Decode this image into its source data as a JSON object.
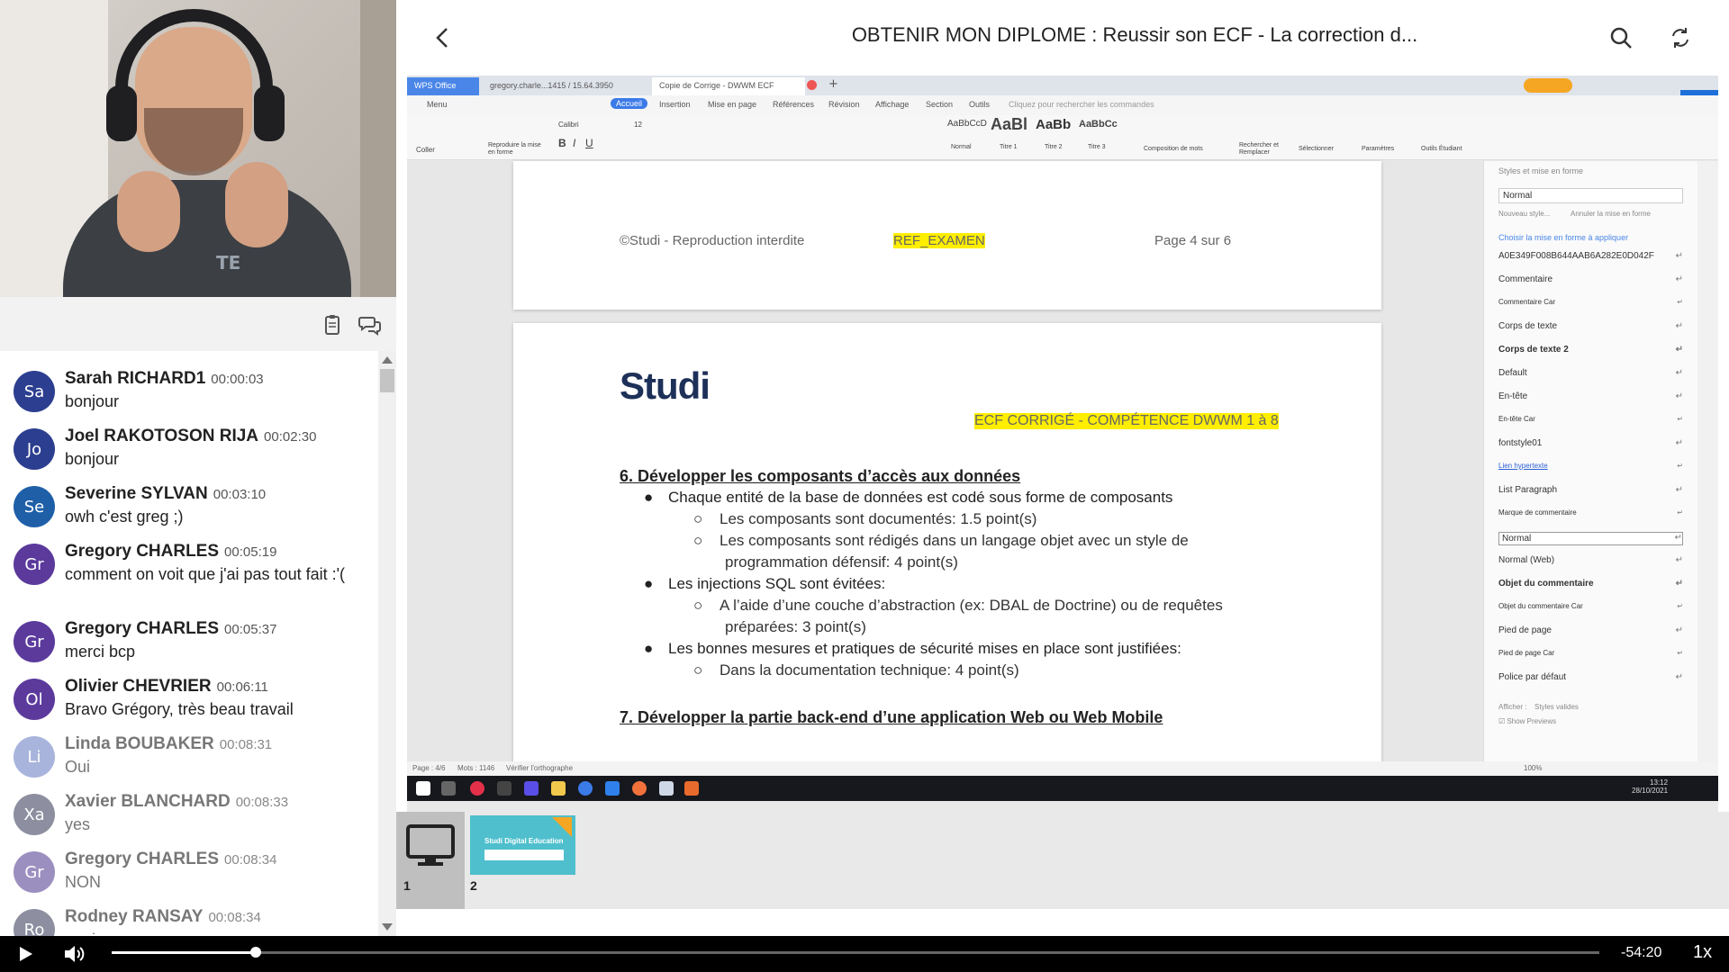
{
  "header": {
    "title": "OBTENIR MON DIPLOME : Reussir son ECF - La correction d..."
  },
  "chat": {
    "messages": [
      {
        "initials": "Sa",
        "author": "Sarah RICHARD1",
        "time": "00:00:03",
        "text": "bonjour",
        "color": "#2c3e8f",
        "faded": false
      },
      {
        "initials": "Jo",
        "author": "Joel RAKOTOSON RIJA",
        "time": "00:02:30",
        "text": "bonjour",
        "color": "#2c3e8f",
        "faded": false
      },
      {
        "initials": "Se",
        "author": "Severine SYLVAN",
        "time": "00:03:10",
        "text": "owh c'est greg ;)",
        "color": "#1f5fa8",
        "faded": false
      },
      {
        "initials": "Gr",
        "author": "Gregory CHARLES",
        "time": "00:05:19",
        "text": "comment on voit que j'ai pas tout fait :'(",
        "color": "#5b3a9c",
        "faded": false
      },
      {
        "initials": "Gr",
        "author": "Gregory CHARLES",
        "time": "00:05:37",
        "text": "merci bcp",
        "color": "#5b3a9c",
        "faded": false
      },
      {
        "initials": "Ol",
        "author": "Olivier CHEVRIER",
        "time": "00:06:11",
        "text": "Bravo Grégory, très beau travail",
        "color": "#5b3a9c",
        "faded": false
      },
      {
        "initials": "Li",
        "author": "Linda BOUBAKER",
        "time": "00:08:31",
        "text": "Oui",
        "color": "#a8b4dc",
        "faded": true
      },
      {
        "initials": "Xa",
        "author": "Xavier BLANCHARD",
        "time": "00:08:33",
        "text": "yes",
        "color": "#8d8fa0",
        "faded": true
      },
      {
        "initials": "Gr",
        "author": "Gregory CHARLES",
        "time": "00:08:34",
        "text": "NON",
        "color": "#9b8fc0",
        "faded": true
      },
      {
        "initials": "Ro",
        "author": "Rodney RANSAY",
        "time": "00:08:34",
        "text": "ouais",
        "color": "#8d8fa0",
        "faded": true
      }
    ]
  },
  "wps": {
    "tabs": [
      "WPS Office",
      "gregory.charle...1415 / 15.64.3950",
      "Copie de Corrige - DWWM ECF"
    ],
    "menu": [
      "Menu",
      "Accueil",
      "Insertion",
      "Mise en page",
      "Références",
      "Révision",
      "Affichage",
      "Section",
      "Outils",
      "Cliquez pour rechercher les commandes"
    ],
    "ribbon": {
      "font_name": "Calibri",
      "font_size": "12",
      "styles": [
        "AaBbCcD",
        "AaBl",
        "AaBb",
        "AaBbCc"
      ],
      "style_names": [
        "Normal",
        "Titre 1",
        "Titre 2",
        "Titre 3"
      ],
      "labels": [
        "Coller",
        "Reproduire la mise en forme",
        "Composition de mots",
        "Rechercher et Remplacer",
        "Sélectionner",
        "Paramètres",
        "Outils Étudiant"
      ]
    }
  },
  "document": {
    "footer_left": "©Studi - Reproduction interdite",
    "footer_mid": "REF_EXAMEN",
    "footer_right": "Page 4 sur 6",
    "logo": "Studi",
    "badge": "ECF CORRIGÉ - COMPÉTENCE DWWM 1 à 8",
    "section6": "6. Développer les composants d’accès aux données",
    "b1": "Chaque entité de la base de données est codé sous forme de composants",
    "b1_1": "Les composants sont documentés:  1.5 point(s)",
    "b1_2a": "Les composants sont rédigés dans un langage objet avec un style de",
    "b1_2b": "programmation défensif: 4 point(s)",
    "b2": "Les injections SQL sont évitées:",
    "b2_1a": "A l’aide d’une couche d’abstraction (ex: DBAL de Doctrine) ou de requêtes",
    "b2_1b": "préparées: 3 point(s)",
    "b3": "Les bonnes mesures et pratiques de sécurité mises en place sont justifiées:",
    "b3_1": "Dans la documentation technique:  4 point(s)",
    "section7": "7. Développer la partie back-end d’une application Web ou Web Mobile"
  },
  "styles_panel": {
    "title": "Styles et mise en forme",
    "current": "Normal",
    "new_style": "Nouveau style...",
    "clear": "Annuler la mise en forme",
    "choose": "Choisir la mise en forme à appliquer",
    "items": [
      "A0E349F008B644AAB6A282E0D042F",
      "Commentaire",
      "Commentaire Car",
      "Corps de texte",
      "Corps de texte 2",
      "Default",
      "En-tête",
      "En-tête Car",
      "fontstyle01",
      "Lien hypertexte",
      "List Paragraph",
      "Marque de commentaire",
      "Normal",
      "Normal (Web)",
      "Objet du commentaire",
      "Objet du commentaire Car",
      "Pied de page",
      "Pied de page Car",
      "Police par défaut"
    ],
    "show_label": "Afficher :",
    "show_value": "Styles valides",
    "preview": "Show Previews"
  },
  "status_bar": {
    "page": "Page : 4/6",
    "words": "Mots : 1146",
    "spell": "Vérifier l'orthographe",
    "zoom": "100%"
  },
  "taskbar": {
    "time": "13:12",
    "date": "28/10/2021"
  },
  "thumbnails": [
    {
      "number": "1"
    },
    {
      "number": "2",
      "caption": "Studi Digital Education"
    }
  ],
  "player": {
    "time_remaining": "-54:20",
    "speed": "1x",
    "progress": 0.097
  }
}
